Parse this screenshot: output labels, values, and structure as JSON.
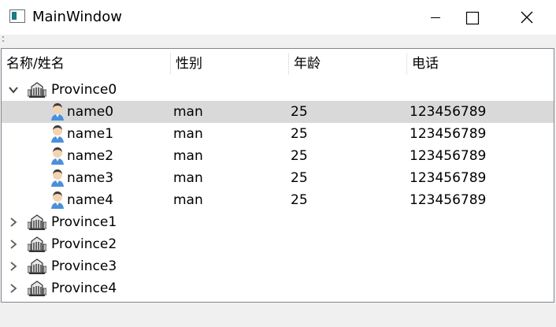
{
  "window": {
    "title": "MainWindow",
    "icon": "app-window-icon",
    "buttons": [
      "minimize-icon",
      "maximize-icon",
      "close-icon"
    ]
  },
  "tree": {
    "headers": [
      "名称/姓名",
      "性别",
      "年龄",
      "电话"
    ],
    "provinces": [
      {
        "name": "Province0",
        "expanded": true,
        "children": [
          {
            "name": "name0",
            "gender": "man",
            "age": "25",
            "phone": "123456789",
            "selected": true
          },
          {
            "name": "name1",
            "gender": "man",
            "age": "25",
            "phone": "123456789"
          },
          {
            "name": "name2",
            "gender": "man",
            "age": "25",
            "phone": "123456789"
          },
          {
            "name": "name3",
            "gender": "man",
            "age": "25",
            "phone": "123456789"
          },
          {
            "name": "name4",
            "gender": "man",
            "age": "25",
            "phone": "123456789"
          }
        ]
      },
      {
        "name": "Province1",
        "expanded": false
      },
      {
        "name": "Province2",
        "expanded": false
      },
      {
        "name": "Province3",
        "expanded": false
      },
      {
        "name": "Province4",
        "expanded": false
      }
    ]
  },
  "colors": {
    "selected_row": "#d9d9d9",
    "tree_border": "#828790",
    "window_bg": "#f0f0f0"
  }
}
